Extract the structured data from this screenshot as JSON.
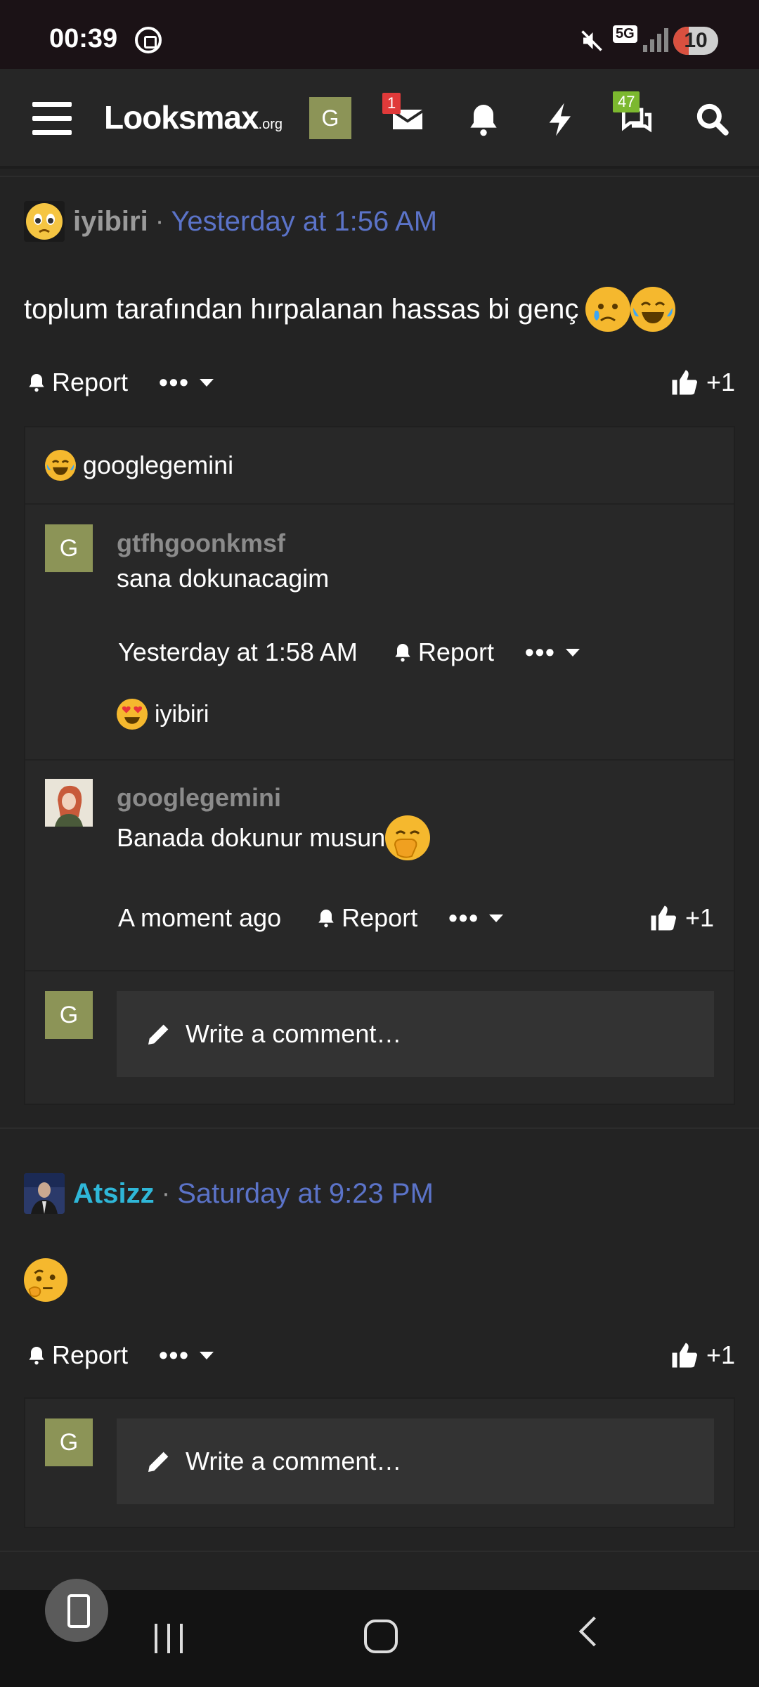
{
  "status_bar": {
    "time": "00:39",
    "network": "5G",
    "battery": "10"
  },
  "navbar": {
    "logo_main": "Looksmax",
    "logo_suffix": ".org",
    "avatar_letter": "G",
    "inbox_badge": "1",
    "conversations_badge": "47"
  },
  "posts": [
    {
      "username": "iyibiri",
      "separator": "·",
      "time": "Yesterday at 1:56 AM",
      "body": "toplum tarafından hırpalanan hassas bi genç",
      "report_label": "Report",
      "like_label": "+1",
      "reactions_summary": "googlegemini",
      "comments": [
        {
          "avatar_letter": "G",
          "username": "gtfhgoonkmsf",
          "text": "sana dokunacagim",
          "time": "Yesterday at 1:58 AM",
          "report_label": "Report",
          "reaction_user": "iyibiri"
        },
        {
          "username": "googlegemini",
          "text": "Banada dokunur musun",
          "time": "A moment ago",
          "report_label": "Report",
          "like_label": "+1"
        }
      ],
      "write_comment": {
        "avatar_letter": "G",
        "placeholder": "Write a comment…"
      }
    },
    {
      "username": "Atsizz",
      "separator": "·",
      "time": "Saturday at 9:23 PM",
      "report_label": "Report",
      "like_label": "+1",
      "write_comment": {
        "avatar_letter": "G",
        "placeholder": "Write a comment…"
      }
    }
  ],
  "colors": {
    "link_blue": "#5b73c8",
    "cyan_user": "#2fb7d8",
    "avatar_olive": "#8c9457",
    "badge_red": "#e03a3a",
    "badge_green": "#7cb82f"
  }
}
